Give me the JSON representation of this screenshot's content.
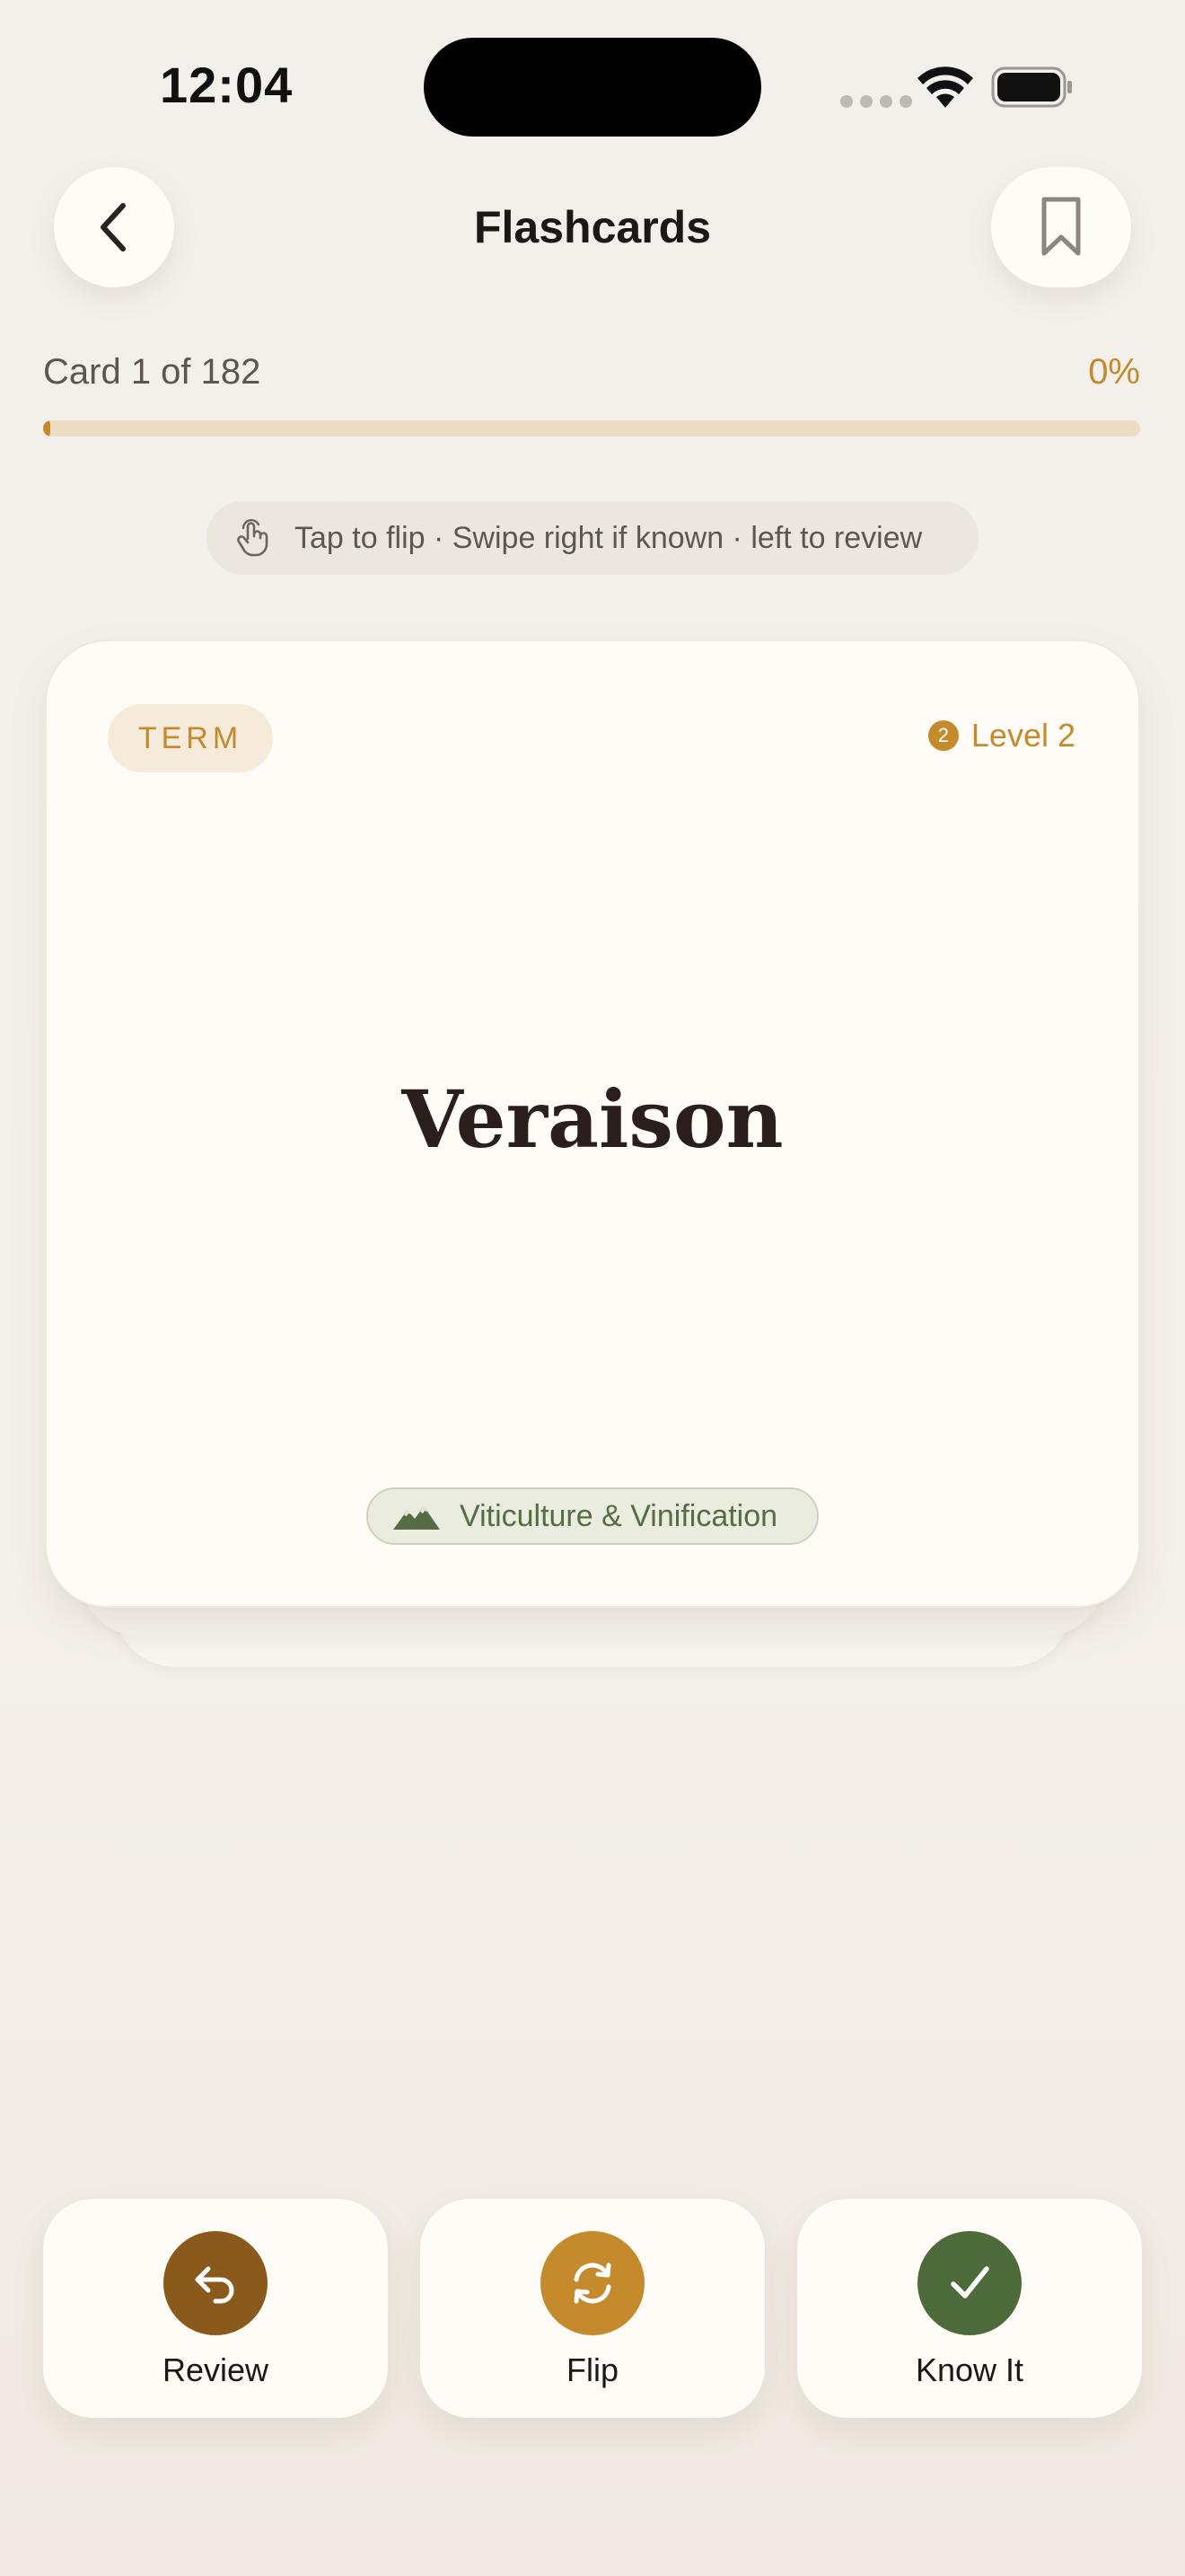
{
  "status_bar": {
    "time": "12:04",
    "icons": [
      "cellular-signal-icon",
      "wifi-icon",
      "battery-icon"
    ]
  },
  "header": {
    "title": "Flashcards",
    "back_icon": "chevron-left-icon",
    "bookmark_icon": "bookmark-icon"
  },
  "progress": {
    "label": "Card 1 of 182",
    "percent_label": "0%",
    "fraction": 0.0
  },
  "hint": {
    "icon": "tap-hand-icon",
    "text": "Tap to flip · Swipe right if known · left to review"
  },
  "card": {
    "badge": "TERM",
    "level_number": "2",
    "level_label": "Level 2",
    "term": "Veraison",
    "category_icon": "mountains-icon",
    "category": "Viticulture & Vinification"
  },
  "actions": [
    {
      "label": "Review",
      "icon": "undo-arrow-icon",
      "color": "#8a5a1c"
    },
    {
      "label": "Flip",
      "icon": "refresh-icon",
      "color": "#c48a2c"
    },
    {
      "label": "Know It",
      "icon": "checkmark-icon",
      "color": "#4e6b3c"
    }
  ],
  "colors": {
    "accent": "#c48a2c",
    "progress_track": "#ecdcc2",
    "card_bg": "#fffcf7",
    "category_text": "#566d43"
  }
}
